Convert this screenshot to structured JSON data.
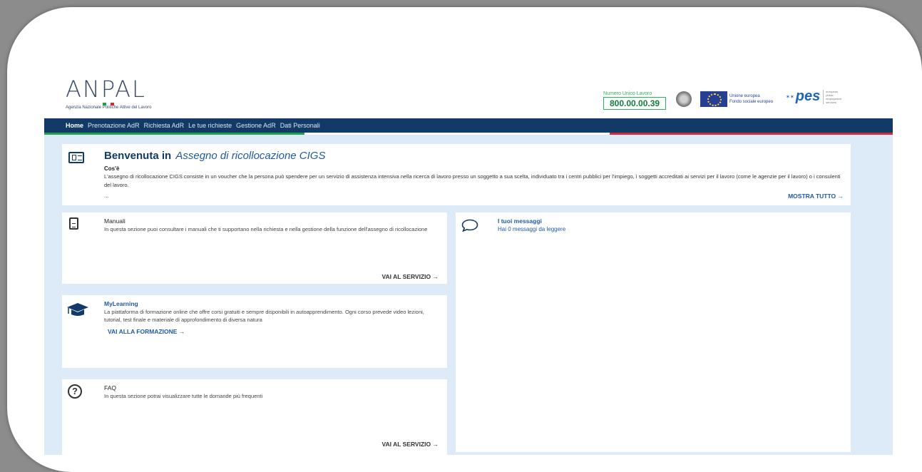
{
  "header": {
    "logo_text": "ANPAL",
    "logo_sub": "Agenzia Nazionale Politiche Attive del Lavoro",
    "numero_unico_label": "Numero Unico Lavoro",
    "numero_unico_value": "800.00.00.39",
    "eu_line1": "Unione europea",
    "eu_line2": "Fondo sociale europeo",
    "pes_logo": "pes",
    "pes_small": "european public employment services",
    "colors": {
      "brand": "#3a4b6a",
      "green": "#2db357",
      "eu_blue": "#243f94"
    }
  },
  "nav": {
    "items": [
      {
        "label": "Home",
        "active": true
      },
      {
        "label": "Prenotazione AdR"
      },
      {
        "label": "Richiesta AdR"
      },
      {
        "label": "Le tue richieste"
      },
      {
        "label": "Gestione AdR"
      },
      {
        "label": "Dati Personali"
      }
    ],
    "colors": {
      "bar": "#113a66",
      "green": "#21a04a",
      "white": "#ffffff",
      "red": "#cf2a36"
    }
  },
  "welcome": {
    "title_bold": "Benvenuta in",
    "title_italic": "Assegno di ricollocazione CIGS",
    "section": "Cos'è",
    "description": "L'assegno di ricollocazione CIGS consiste in un voucher che la persona può spendere per un servizio di assistenza intensiva nella ricerca di lavoro presso un soggetto a sua scelta, individuato tra i centri pubblici per l'impiego, i soggetti accreditati ai servizi per il lavoro (come le agenzie per il lavoro) o i consulenti del lavoro.",
    "ellipsis": "...",
    "more_label": "MOSTRA TUTTO →"
  },
  "manuali": {
    "title": "Manuali",
    "description": "In questa sezione puoi consultare i manuali che ti supportano nella richiesta e nella gestione della funzione dell'assegno di ricollocazione",
    "link": "VAI AL SERVIZIO →"
  },
  "mylearning": {
    "title": "MyLearning",
    "description": "La piattaforma di formazione online che offre corsi gratuiti e sempre disponibili in autoapprendimento. Ogni corso prevede video lezioni, tutorial, test finale e materiale di approfondimento di diversa natura",
    "link": "VAI ALLA FORMAZIONE →"
  },
  "faq": {
    "title": "FAQ",
    "description": "In questa sezione potrai visualizzare tutte le domande più frequenti",
    "icon_glyph": "?",
    "link": "VAI AL SERVIZIO →"
  },
  "messages": {
    "title": "I tuoi messaggi",
    "subtitle": "Hai 0 messaggi da leggere"
  }
}
